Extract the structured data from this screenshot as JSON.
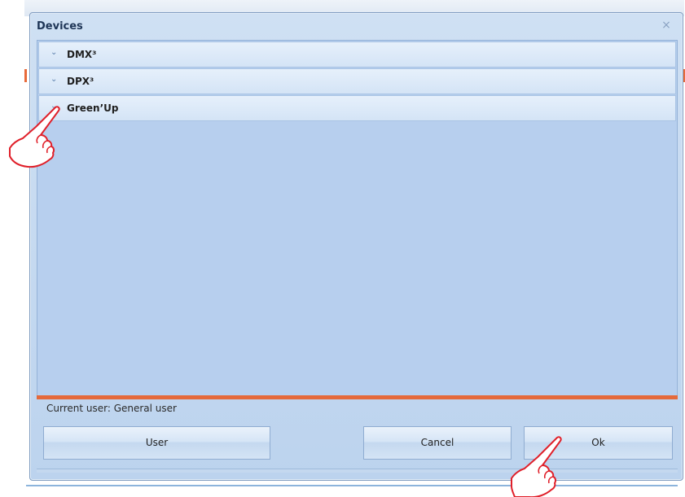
{
  "dialog": {
    "title": "Devices",
    "close_symbol": "×"
  },
  "groups": [
    {
      "label": "DMX³",
      "icon": "chevron-down-icon"
    },
    {
      "label": "DPX³",
      "icon": "chevron-down-icon"
    },
    {
      "label": "Green’Up",
      "icon": "chevron-down-icon"
    }
  ],
  "status": {
    "current_user": "Current user: General user"
  },
  "buttons": {
    "user": "User",
    "cancel": "Cancel",
    "ok": "Ok"
  },
  "colors": {
    "accent_orange": "#e5693a",
    "pane_blue": "#b7cfee",
    "hand_red": "#e0202a"
  }
}
